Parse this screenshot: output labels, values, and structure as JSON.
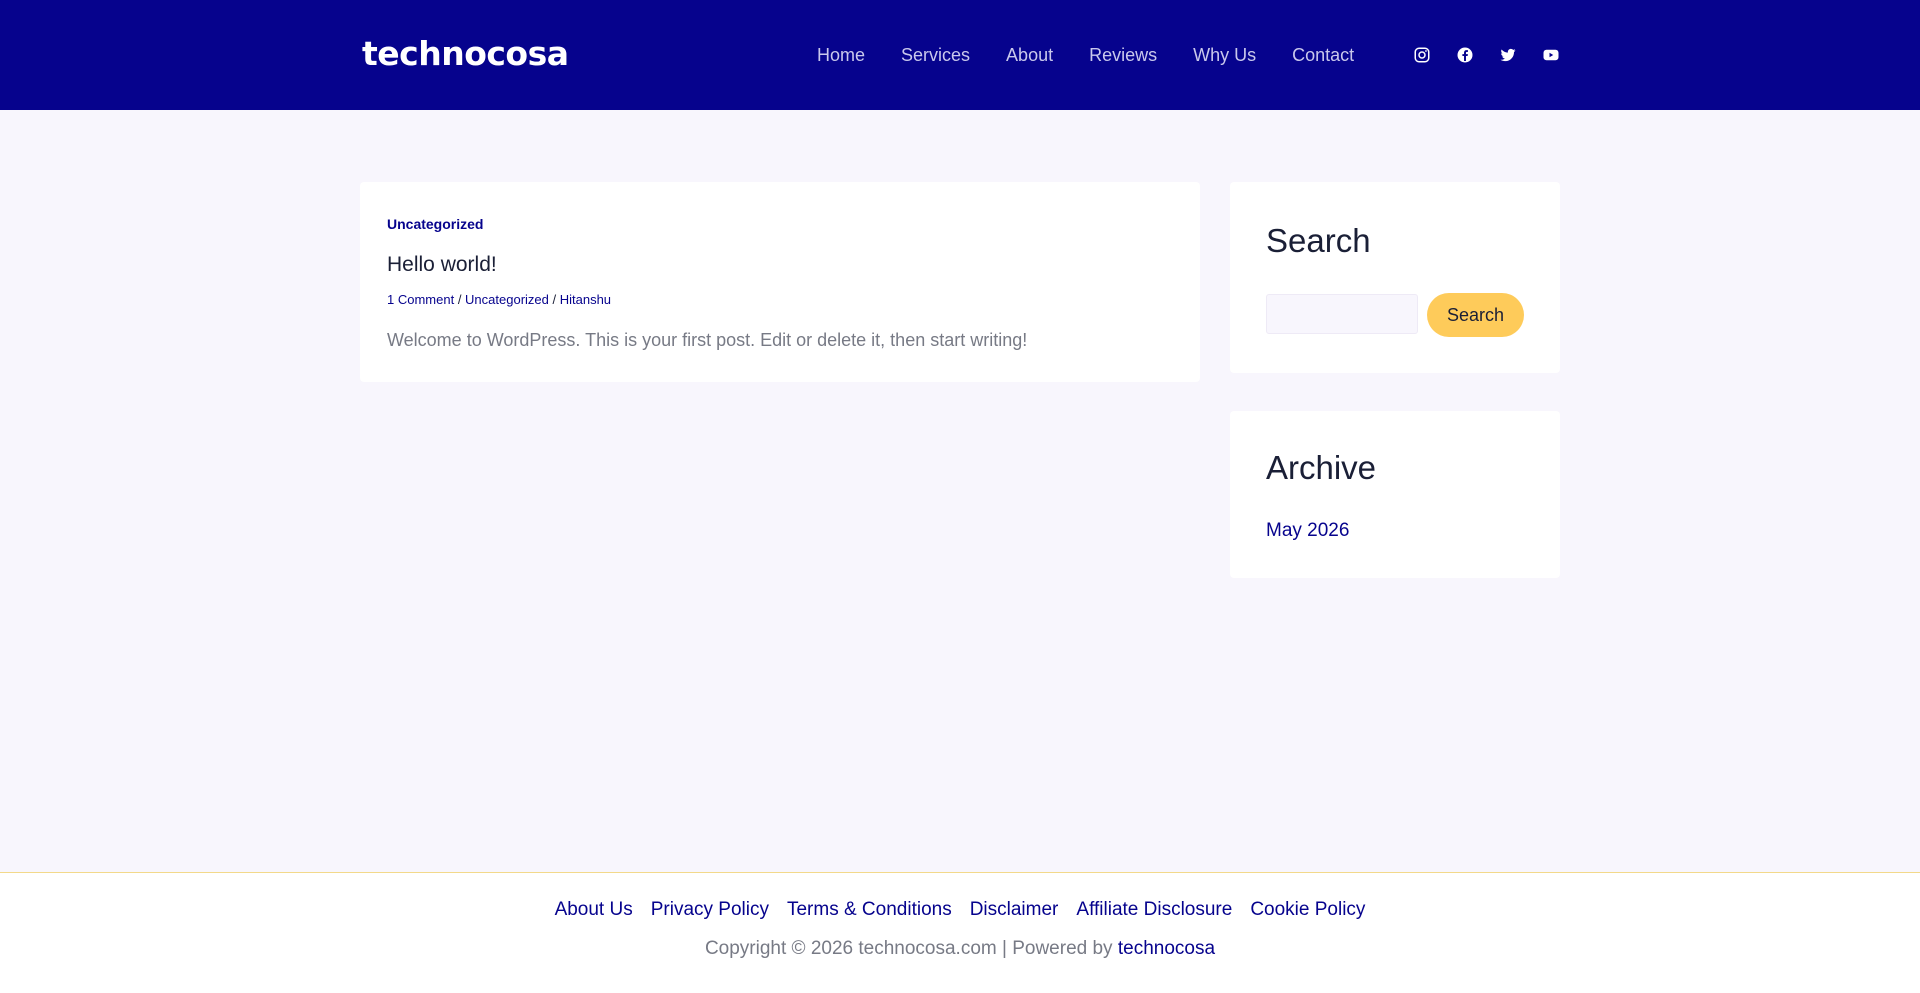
{
  "header": {
    "logo": "technocosa",
    "nav": [
      "Home",
      "Services",
      "About",
      "Reviews",
      "Why Us",
      "Contact"
    ],
    "social": [
      "instagram-icon",
      "facebook-icon",
      "twitter-icon",
      "youtube-icon"
    ]
  },
  "post": {
    "category": "Uncategorized",
    "title": "Hello world!",
    "meta": {
      "comments": "1 Comment",
      "category": "Uncategorized",
      "author": "Hitanshu",
      "separator": " / "
    },
    "excerpt": "Welcome to WordPress. This is your first post. Edit or delete it, then start writing!"
  },
  "sidebar": {
    "search": {
      "title": "Search",
      "placeholder": "",
      "button": "Search"
    },
    "archive": {
      "title": "Archive",
      "items": [
        "May 2026"
      ]
    }
  },
  "footer": {
    "links": [
      "About Us",
      "Privacy Policy",
      "Terms & Conditions",
      "Disclaimer",
      "Affiliate Disclosure",
      "Cookie Policy"
    ],
    "copyright_prefix": "Copyright © 2026 technocosa.com | Powered by ",
    "copyright_link": "technocosa"
  },
  "colors": {
    "header_bg": "#06038d",
    "accent": "#06038d",
    "button": "#fecb5a",
    "page_bg": "#f8f6fd"
  }
}
